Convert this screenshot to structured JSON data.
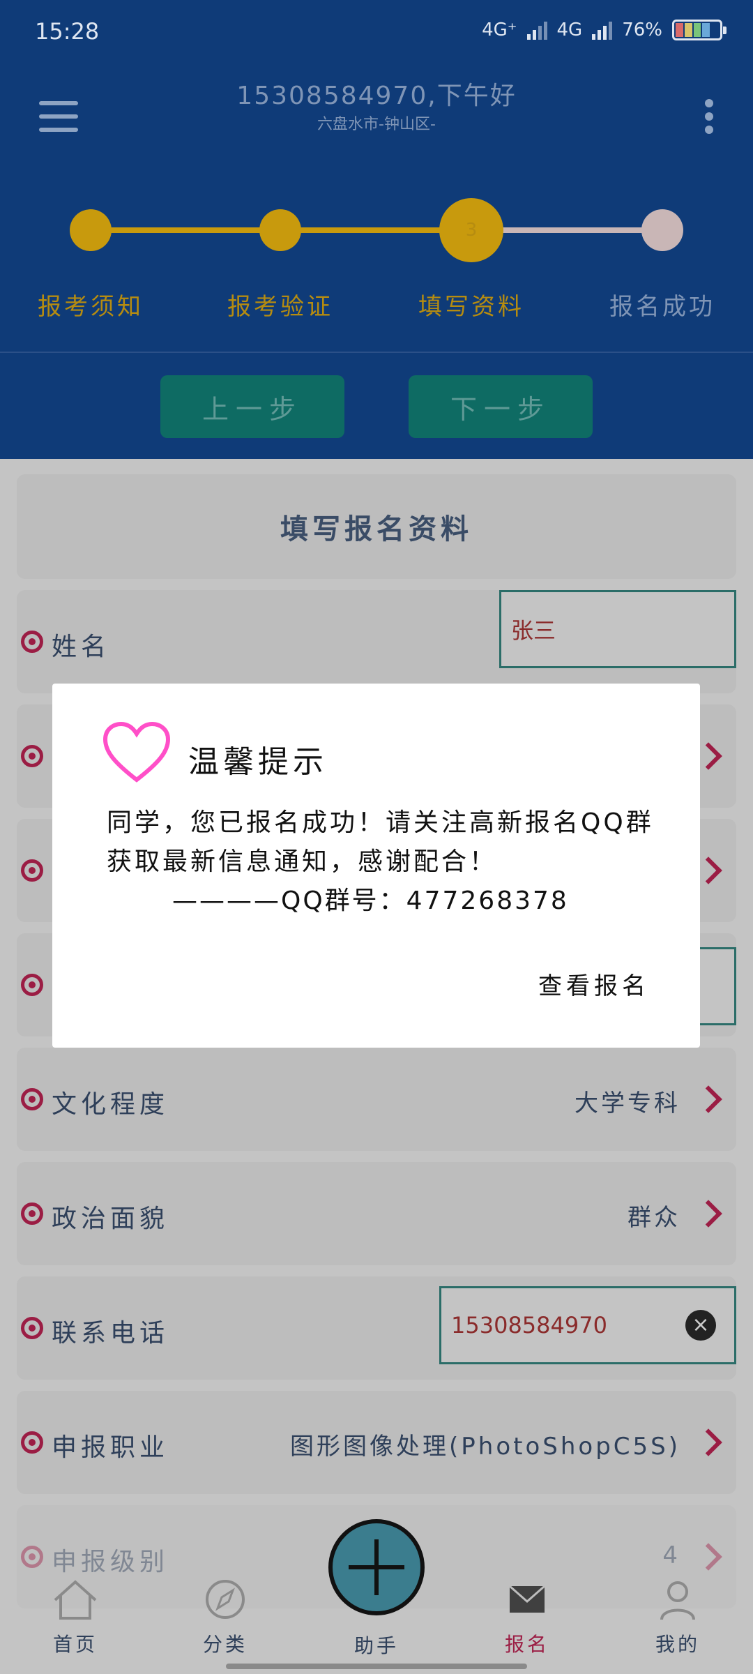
{
  "status_bar": {
    "time": "15:28",
    "net1": "4G⁺",
    "net2": "4G",
    "battery": "76%"
  },
  "header": {
    "greeting": "15308584970,下午好",
    "location": "六盘水市-钟山区-"
  },
  "steps": {
    "items": [
      {
        "label": "报考须知",
        "state": "done"
      },
      {
        "label": "报考验证",
        "state": "done"
      },
      {
        "label": "填写资料",
        "state": "current",
        "number": "3"
      },
      {
        "label": "报名成功",
        "state": "pending"
      }
    ],
    "prev_label": "上一步",
    "next_label": "下一步"
  },
  "form": {
    "title": "填写报名资料",
    "name": {
      "label": "姓名",
      "value": "张三"
    },
    "education": {
      "label": "文化程度",
      "value": "大学专科"
    },
    "political": {
      "label": "政治面貌",
      "value": "群众"
    },
    "phone": {
      "label": "联系电话",
      "value": "15308584970"
    },
    "occupation": {
      "label": "申报职业",
      "value": "图形图像处理(PhotoShopC5S)"
    },
    "level": {
      "label": "申报级别",
      "value": "4"
    }
  },
  "bottom_nav": [
    {
      "label": "首页",
      "icon": "home-icon"
    },
    {
      "label": "分类",
      "icon": "compass-icon"
    },
    {
      "label": "助手",
      "icon": "plus-icon"
    },
    {
      "label": "报名",
      "icon": "mail-icon",
      "active": true
    },
    {
      "label": "我的",
      "icon": "user-icon"
    }
  ],
  "dialog": {
    "title": "温馨提示",
    "message": "同学，您已报名成功！请关注高新报名QQ群获取最新信息通知，感谢配合！",
    "qq_line": "————QQ群号：477268378",
    "button": "查看报名"
  },
  "colors": {
    "header_bg": "#0f3b78",
    "step_active": "#c89a0d",
    "step_pending": "#c9b6b6",
    "button_green": "#0e6b63",
    "accent_pink": "#9b1d44",
    "dialog_heart": "#ff4fc8"
  }
}
